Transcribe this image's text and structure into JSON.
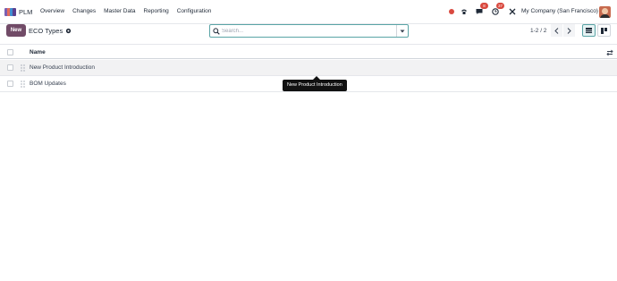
{
  "navbar": {
    "app_name": "PLM",
    "menu": [
      "Overview",
      "Changes",
      "Master Data",
      "Reporting",
      "Configuration"
    ],
    "messages_count": "8",
    "activities_count": "37",
    "company": "My Company (San Francisco)",
    "icons": [
      "apps-logo",
      "recording-dot",
      "phone-icon",
      "chat-icon",
      "clock-icon",
      "tools-icon",
      "avatar"
    ]
  },
  "control_panel": {
    "new_label": "New",
    "breadcrumb": "ECO Types",
    "search_placeholder": "Search...",
    "pager": "1-2 / 2"
  },
  "table": {
    "column_name": "Name",
    "rows": [
      {
        "name": "New Product Introduction"
      },
      {
        "name": "BOM Updates"
      }
    ]
  },
  "tooltip": "New Product Introduction",
  "colors": {
    "brand": "#714b67",
    "accent": "#5aa4a6",
    "badge": "#d9493f"
  }
}
